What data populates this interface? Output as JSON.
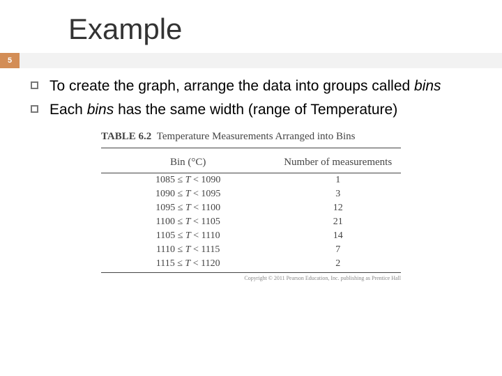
{
  "slide": {
    "title": "Example",
    "number": "5"
  },
  "bullets": {
    "b1_pre": "To create the graph, arrange the data into groups called ",
    "b1_em": "bins",
    "b2_pre": "Each ",
    "b2_em": "bins",
    "b2_post": " has the same width (range of Temperature)"
  },
  "table": {
    "label": "TABLE 6.2",
    "caption": "Temperature Measurements Arranged into Bins",
    "col1": "Bin (°C)",
    "col2": "Number of measurements",
    "copyright": "Copyright © 2011 Pearson Education, Inc. publishing as Prentice Hall"
  },
  "chart_data": {
    "type": "table",
    "columns": [
      "Bin (°C)",
      "Number of measurements"
    ],
    "rows": [
      {
        "low": 1085,
        "high": 1090,
        "count": 1
      },
      {
        "low": 1090,
        "high": 1095,
        "count": 3
      },
      {
        "low": 1095,
        "high": 1100,
        "count": 12
      },
      {
        "low": 1100,
        "high": 1105,
        "count": 21
      },
      {
        "low": 1105,
        "high": 1110,
        "count": 14
      },
      {
        "low": 1110,
        "high": 1115,
        "count": 7
      },
      {
        "low": 1115,
        "high": 1120,
        "count": 2
      }
    ]
  }
}
